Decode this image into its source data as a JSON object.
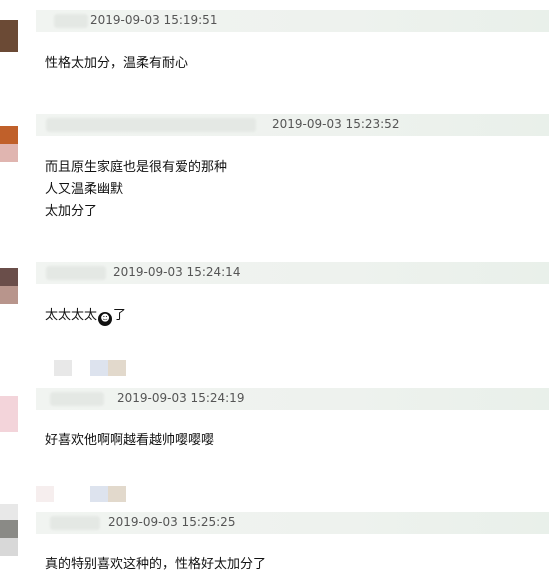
{
  "comments": [
    {
      "time": "2019-09-03 15:19:51",
      "lines": [
        "性格太加分，温柔有耐心"
      ]
    },
    {
      "time": "2019-09-03 15:23:52",
      "lines": [
        "而且原生家庭也是很有爱的那种",
        "人又温柔幽默",
        "太加分了"
      ]
    },
    {
      "time": "2019-09-03 15:24:14",
      "lines": [
        "太太太太",
        "了"
      ],
      "emoji": "face-icon"
    },
    {
      "time": "2019-09-03 15:24:19",
      "lines": [
        "好喜欢他啊啊越看越帅嘤嘤嘤"
      ]
    },
    {
      "time": "2019-09-03 15:25:25",
      "lines": [
        "真的特别喜欢这种的，性格好太加分了"
      ]
    }
  ],
  "colors": {
    "header_bg": "#eef2ee",
    "avatar_1": "#6b4a35",
    "avatar_2a": "#c0602a",
    "avatar_2b": "#e0b5b0",
    "avatar_3a": "#6a4e4a",
    "avatar_3b": "#b8958c",
    "avatar_4": "#f3d4da",
    "avatar_5a": "#e8e8e8",
    "avatar_5b": "#8a8a86",
    "avatar_5c": "#d8d8d8"
  }
}
